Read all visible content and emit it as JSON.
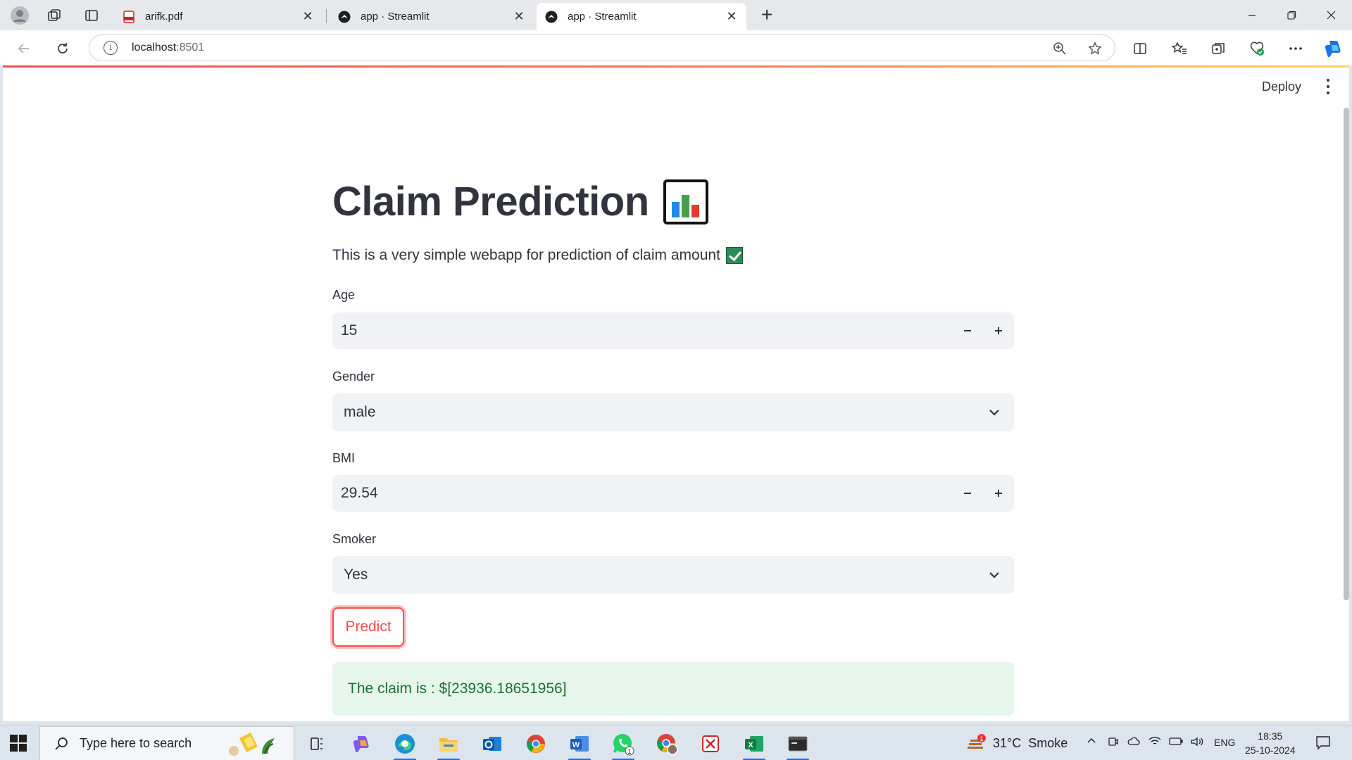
{
  "browser": {
    "tabs": [
      {
        "label": "arifk.pdf",
        "active": false
      },
      {
        "label": "app · Streamlit",
        "active": false
      },
      {
        "label": "app · Streamlit",
        "active": true
      }
    ],
    "url_host": "localhost",
    "url_port": ":8501",
    "colors": {
      "accent": "#ff4b4b",
      "success_bg": "#e6f6ea",
      "success_text": "#177233",
      "input_bg": "#f0f2f6"
    }
  },
  "toolbar": {
    "deploy_label": "Deploy"
  },
  "app": {
    "title": "Claim Prediction",
    "description": "This is a very simple webapp for prediction of claim amount",
    "fields": {
      "age": {
        "label": "Age",
        "value": "15"
      },
      "gender": {
        "label": "Gender",
        "value": "male"
      },
      "bmi": {
        "label": "BMI",
        "value": "29.54"
      },
      "smoker": {
        "label": "Smoker",
        "value": "Yes"
      }
    },
    "predict_label": "Predict",
    "result_text": "The claim is : $[23936.18651956]"
  },
  "taskbar": {
    "search_placeholder": "Type here to search",
    "weather": {
      "temp": "31°C",
      "condition": "Smoke"
    },
    "language": "ENG",
    "time": "18:35",
    "date": "25-10-2024",
    "whatsapp_badge": "1",
    "weather_badge": "1"
  }
}
